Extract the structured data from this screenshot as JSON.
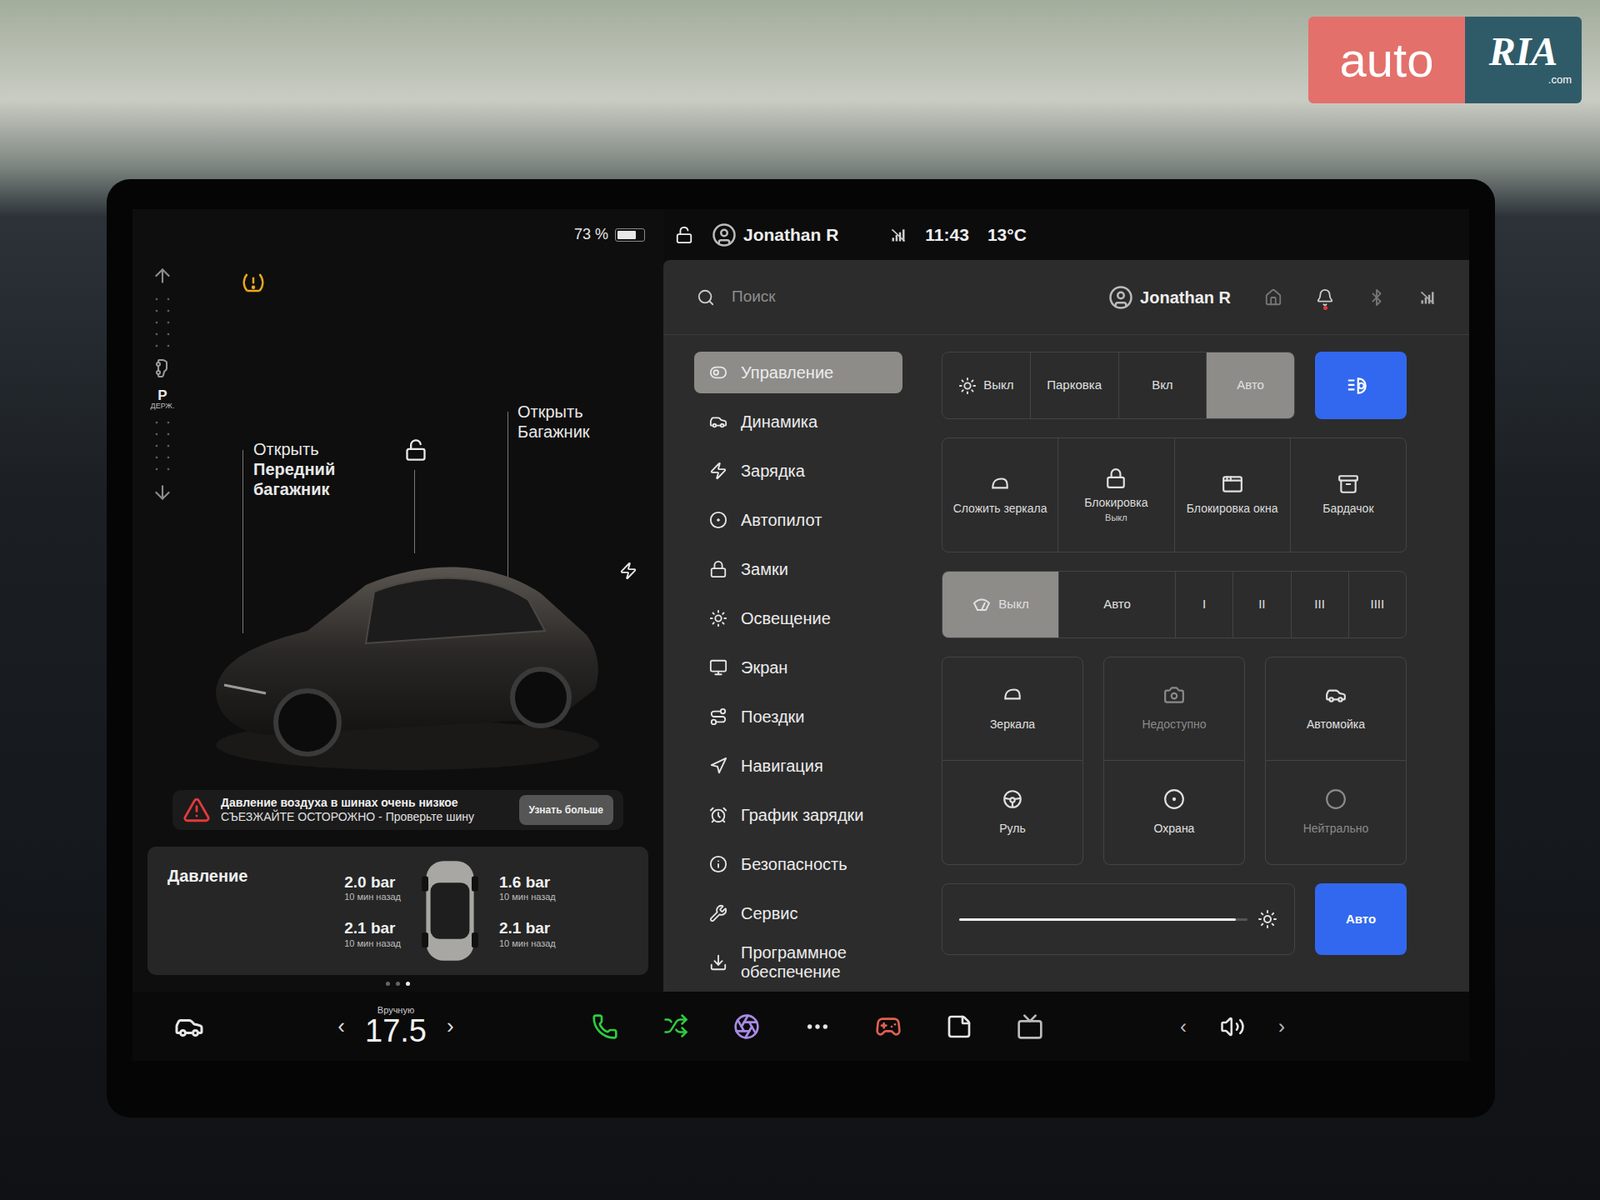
{
  "watermark": {
    "brand": "auto",
    "mark": "RIA",
    "domain": ".com"
  },
  "status_bar": {
    "battery": "73 %",
    "battery_level": 0.73,
    "user": "Jonathan R",
    "time": "11:43",
    "temperature": "13°C",
    "locked": false
  },
  "gear": {
    "selected": "P",
    "hold": "ДЕРЖ."
  },
  "car": {
    "frunk_label": [
      "Открыть",
      "Передний",
      "багажник"
    ],
    "trunk_label": [
      "Открыть",
      "Багажник"
    ],
    "tire_warning": true,
    "charge_port": true
  },
  "alert": {
    "title": "Давление воздуха в шинах очень низкое",
    "message": "СЪЕЗЖАЙТЕ ОСТОРОЖНО - Проверьте шину",
    "button": "Узнать больше"
  },
  "pressure": {
    "title": "Давление",
    "tires": [
      {
        "value": "2.0 bar",
        "age": "10 мин назад"
      },
      {
        "value": "1.6 bar",
        "age": "10 мин назад"
      },
      {
        "value": "2.1 bar",
        "age": "10 мин назад"
      },
      {
        "value": "2.1 bar",
        "age": "10 мин назад"
      }
    ]
  },
  "page_dots": [
    {
      "selected": false
    },
    {
      "selected": false
    },
    {
      "selected": true
    }
  ],
  "search": {
    "placeholder": "Поиск"
  },
  "profile": {
    "user": "Jonathan R",
    "notifications_unread": true
  },
  "menu": [
    {
      "label": "Управление",
      "selected": true
    },
    {
      "label": "Динамика",
      "selected": false
    },
    {
      "label": "Зарядка",
      "selected": false
    },
    {
      "label": "Автопилот",
      "selected": false
    },
    {
      "label": "Замки",
      "selected": false
    },
    {
      "label": "Освещение",
      "selected": false
    },
    {
      "label": "Экран",
      "selected": false
    },
    {
      "label": "Поездки",
      "selected": false
    },
    {
      "label": "Навигация",
      "selected": false
    },
    {
      "label": "График зарядки",
      "selected": false
    },
    {
      "label": "Безопасность",
      "selected": false
    },
    {
      "label": "Сервис",
      "selected": false
    },
    {
      "label": "Программное обеспечение",
      "selected": false
    }
  ],
  "headlights": {
    "options": [
      {
        "label": "Выкл",
        "selected": false
      },
      {
        "label": "Парковка",
        "selected": false
      },
      {
        "label": "Вкл",
        "selected": false
      },
      {
        "label": "Авто",
        "selected": true
      }
    ],
    "auto_high_beam": true
  },
  "quick_buttons": [
    {
      "label": "Сложить зеркала",
      "sublabel": ""
    },
    {
      "label": "Блокировка",
      "sublabel": "Выкл"
    },
    {
      "label": "Блокировка окна",
      "sublabel": ""
    },
    {
      "label": "Бардачок",
      "sublabel": ""
    }
  ],
  "wipers": [
    {
      "label": "Выкл",
      "selected": true
    },
    {
      "label": "Авто",
      "selected": false
    },
    {
      "label": "I",
      "selected": false
    },
    {
      "label": "II",
      "selected": false
    },
    {
      "label": "III",
      "selected": false
    },
    {
      "label": "IIII",
      "selected": false
    }
  ],
  "tiles": [
    {
      "label": "Зеркала",
      "disabled": false
    },
    {
      "label": "Недоступно",
      "disabled": true
    },
    {
      "label": "Автомойка",
      "disabled": false
    },
    {
      "label": "Руль",
      "disabled": false
    },
    {
      "label": "Охрана",
      "disabled": false
    },
    {
      "label": "Нейтрально",
      "disabled": true
    }
  ],
  "brightness": {
    "level": 0.96,
    "auto_label": "Авто",
    "auto": true
  },
  "dock": {
    "climate_mode": "Вручную",
    "temperature": "17.5",
    "prev": "‹",
    "next": "›",
    "volume_prev": "‹",
    "volume_next": "›"
  }
}
